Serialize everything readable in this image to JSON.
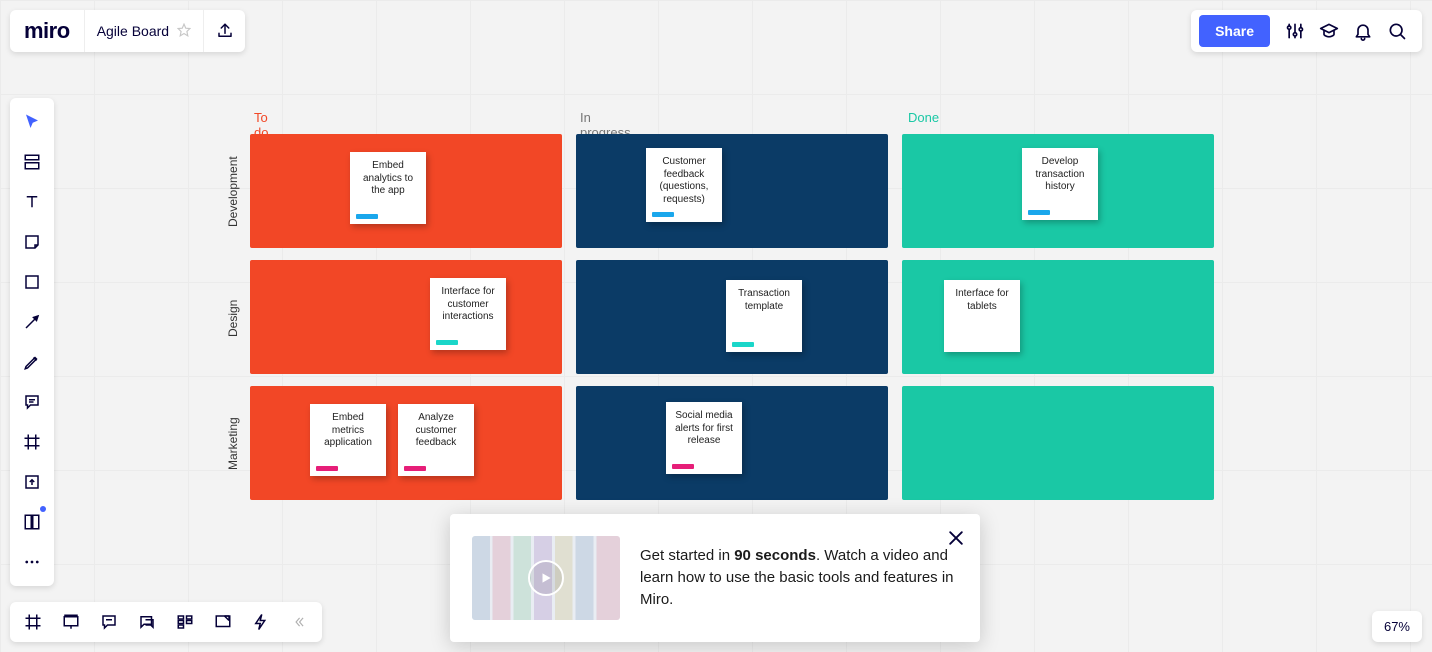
{
  "app": {
    "logo_text": "miro",
    "board_title": "Agile Board"
  },
  "topbar": {
    "share_label": "Share"
  },
  "zoom": {
    "label": "67%"
  },
  "popup": {
    "line1_prefix": "Get started in ",
    "line1_bold": "90 seconds",
    "line1_suffix": ". Watch a video and learn how to use the basic tools and features in Miro."
  },
  "board": {
    "columns": {
      "todo": {
        "label": "To do",
        "color": "#f24726"
      },
      "progress": {
        "label": "In progress",
        "color": "#e4e4e4"
      },
      "done": {
        "label": "Done",
        "color": "#1ac8a5"
      }
    },
    "swimlanes": [
      {
        "key": "dev",
        "label": "Development"
      },
      {
        "key": "design",
        "label": "Design"
      },
      {
        "key": "marketing",
        "label": "Marketing"
      }
    ],
    "cards": {
      "dev_todo_0": {
        "text": "Embed analytics to the app",
        "tag": "blue"
      },
      "dev_prog_0": {
        "text": "Customer feedback (questions, requests)",
        "tag": "blue"
      },
      "dev_done_0": {
        "text": "Develop transaction history",
        "tag": "blue"
      },
      "design_todo_0": {
        "text": "Interface for customer interactions",
        "tag": "cyan"
      },
      "design_prog_0": {
        "text": "Transaction template",
        "tag": "cyan"
      },
      "design_done_0": {
        "text": "Interface for tablets",
        "tag": ""
      },
      "marketing_todo_0": {
        "text": "Embed metrics application",
        "tag": "pink"
      },
      "marketing_todo_1": {
        "text": "Analyze customer feedback",
        "tag": "pink"
      },
      "marketing_prog_0": {
        "text": "Social media alerts for first release",
        "tag": "pink"
      }
    }
  }
}
